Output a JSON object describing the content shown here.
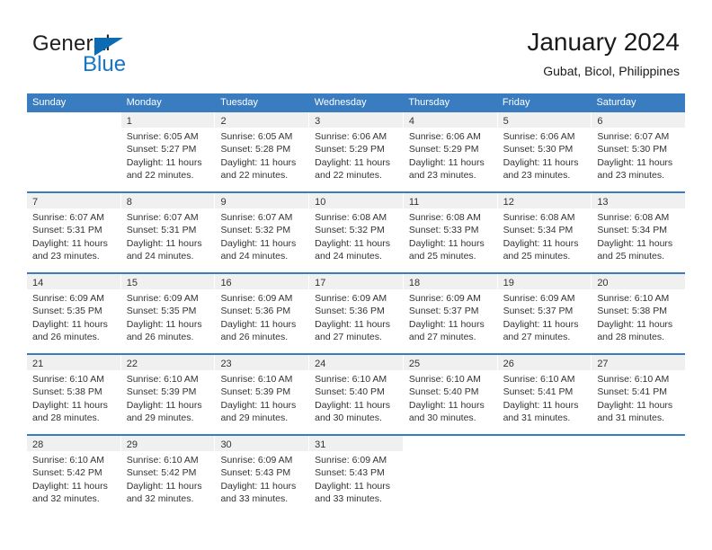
{
  "brand": {
    "name_part1": "General",
    "name_part2": "Blue",
    "triangle_icon": "triangle-icon",
    "color_blue": "#1676c6",
    "color_triangle": "#0b6cb3"
  },
  "header": {
    "title": "January 2024",
    "subtitle": "Gubat, Bicol, Philippines"
  },
  "theme": {
    "header_row_bg": "#3a7cc0",
    "daynum_band_bg": "#f0f0f0",
    "text_color": "#333333"
  },
  "weekdays": [
    "Sunday",
    "Monday",
    "Tuesday",
    "Wednesday",
    "Thursday",
    "Friday",
    "Saturday"
  ],
  "weeks": [
    [
      {
        "day": "",
        "sunrise": "",
        "sunset": "",
        "daylight_line1": "",
        "daylight_line2": ""
      },
      {
        "day": "1",
        "sunrise": "Sunrise: 6:05 AM",
        "sunset": "Sunset: 5:27 PM",
        "daylight_line1": "Daylight: 11 hours",
        "daylight_line2": "and 22 minutes."
      },
      {
        "day": "2",
        "sunrise": "Sunrise: 6:05 AM",
        "sunset": "Sunset: 5:28 PM",
        "daylight_line1": "Daylight: 11 hours",
        "daylight_line2": "and 22 minutes."
      },
      {
        "day": "3",
        "sunrise": "Sunrise: 6:06 AM",
        "sunset": "Sunset: 5:29 PM",
        "daylight_line1": "Daylight: 11 hours",
        "daylight_line2": "and 22 minutes."
      },
      {
        "day": "4",
        "sunrise": "Sunrise: 6:06 AM",
        "sunset": "Sunset: 5:29 PM",
        "daylight_line1": "Daylight: 11 hours",
        "daylight_line2": "and 23 minutes."
      },
      {
        "day": "5",
        "sunrise": "Sunrise: 6:06 AM",
        "sunset": "Sunset: 5:30 PM",
        "daylight_line1": "Daylight: 11 hours",
        "daylight_line2": "and 23 minutes."
      },
      {
        "day": "6",
        "sunrise": "Sunrise: 6:07 AM",
        "sunset": "Sunset: 5:30 PM",
        "daylight_line1": "Daylight: 11 hours",
        "daylight_line2": "and 23 minutes."
      }
    ],
    [
      {
        "day": "7",
        "sunrise": "Sunrise: 6:07 AM",
        "sunset": "Sunset: 5:31 PM",
        "daylight_line1": "Daylight: 11 hours",
        "daylight_line2": "and 23 minutes."
      },
      {
        "day": "8",
        "sunrise": "Sunrise: 6:07 AM",
        "sunset": "Sunset: 5:31 PM",
        "daylight_line1": "Daylight: 11 hours",
        "daylight_line2": "and 24 minutes."
      },
      {
        "day": "9",
        "sunrise": "Sunrise: 6:07 AM",
        "sunset": "Sunset: 5:32 PM",
        "daylight_line1": "Daylight: 11 hours",
        "daylight_line2": "and 24 minutes."
      },
      {
        "day": "10",
        "sunrise": "Sunrise: 6:08 AM",
        "sunset": "Sunset: 5:32 PM",
        "daylight_line1": "Daylight: 11 hours",
        "daylight_line2": "and 24 minutes."
      },
      {
        "day": "11",
        "sunrise": "Sunrise: 6:08 AM",
        "sunset": "Sunset: 5:33 PM",
        "daylight_line1": "Daylight: 11 hours",
        "daylight_line2": "and 25 minutes."
      },
      {
        "day": "12",
        "sunrise": "Sunrise: 6:08 AM",
        "sunset": "Sunset: 5:34 PM",
        "daylight_line1": "Daylight: 11 hours",
        "daylight_line2": "and 25 minutes."
      },
      {
        "day": "13",
        "sunrise": "Sunrise: 6:08 AM",
        "sunset": "Sunset: 5:34 PM",
        "daylight_line1": "Daylight: 11 hours",
        "daylight_line2": "and 25 minutes."
      }
    ],
    [
      {
        "day": "14",
        "sunrise": "Sunrise: 6:09 AM",
        "sunset": "Sunset: 5:35 PM",
        "daylight_line1": "Daylight: 11 hours",
        "daylight_line2": "and 26 minutes."
      },
      {
        "day": "15",
        "sunrise": "Sunrise: 6:09 AM",
        "sunset": "Sunset: 5:35 PM",
        "daylight_line1": "Daylight: 11 hours",
        "daylight_line2": "and 26 minutes."
      },
      {
        "day": "16",
        "sunrise": "Sunrise: 6:09 AM",
        "sunset": "Sunset: 5:36 PM",
        "daylight_line1": "Daylight: 11 hours",
        "daylight_line2": "and 26 minutes."
      },
      {
        "day": "17",
        "sunrise": "Sunrise: 6:09 AM",
        "sunset": "Sunset: 5:36 PM",
        "daylight_line1": "Daylight: 11 hours",
        "daylight_line2": "and 27 minutes."
      },
      {
        "day": "18",
        "sunrise": "Sunrise: 6:09 AM",
        "sunset": "Sunset: 5:37 PM",
        "daylight_line1": "Daylight: 11 hours",
        "daylight_line2": "and 27 minutes."
      },
      {
        "day": "19",
        "sunrise": "Sunrise: 6:09 AM",
        "sunset": "Sunset: 5:37 PM",
        "daylight_line1": "Daylight: 11 hours",
        "daylight_line2": "and 27 minutes."
      },
      {
        "day": "20",
        "sunrise": "Sunrise: 6:10 AM",
        "sunset": "Sunset: 5:38 PM",
        "daylight_line1": "Daylight: 11 hours",
        "daylight_line2": "and 28 minutes."
      }
    ],
    [
      {
        "day": "21",
        "sunrise": "Sunrise: 6:10 AM",
        "sunset": "Sunset: 5:38 PM",
        "daylight_line1": "Daylight: 11 hours",
        "daylight_line2": "and 28 minutes."
      },
      {
        "day": "22",
        "sunrise": "Sunrise: 6:10 AM",
        "sunset": "Sunset: 5:39 PM",
        "daylight_line1": "Daylight: 11 hours",
        "daylight_line2": "and 29 minutes."
      },
      {
        "day": "23",
        "sunrise": "Sunrise: 6:10 AM",
        "sunset": "Sunset: 5:39 PM",
        "daylight_line1": "Daylight: 11 hours",
        "daylight_line2": "and 29 minutes."
      },
      {
        "day": "24",
        "sunrise": "Sunrise: 6:10 AM",
        "sunset": "Sunset: 5:40 PM",
        "daylight_line1": "Daylight: 11 hours",
        "daylight_line2": "and 30 minutes."
      },
      {
        "day": "25",
        "sunrise": "Sunrise: 6:10 AM",
        "sunset": "Sunset: 5:40 PM",
        "daylight_line1": "Daylight: 11 hours",
        "daylight_line2": "and 30 minutes."
      },
      {
        "day": "26",
        "sunrise": "Sunrise: 6:10 AM",
        "sunset": "Sunset: 5:41 PM",
        "daylight_line1": "Daylight: 11 hours",
        "daylight_line2": "and 31 minutes."
      },
      {
        "day": "27",
        "sunrise": "Sunrise: 6:10 AM",
        "sunset": "Sunset: 5:41 PM",
        "daylight_line1": "Daylight: 11 hours",
        "daylight_line2": "and 31 minutes."
      }
    ],
    [
      {
        "day": "28",
        "sunrise": "Sunrise: 6:10 AM",
        "sunset": "Sunset: 5:42 PM",
        "daylight_line1": "Daylight: 11 hours",
        "daylight_line2": "and 32 minutes."
      },
      {
        "day": "29",
        "sunrise": "Sunrise: 6:10 AM",
        "sunset": "Sunset: 5:42 PM",
        "daylight_line1": "Daylight: 11 hours",
        "daylight_line2": "and 32 minutes."
      },
      {
        "day": "30",
        "sunrise": "Sunrise: 6:09 AM",
        "sunset": "Sunset: 5:43 PM",
        "daylight_line1": "Daylight: 11 hours",
        "daylight_line2": "and 33 minutes."
      },
      {
        "day": "31",
        "sunrise": "Sunrise: 6:09 AM",
        "sunset": "Sunset: 5:43 PM",
        "daylight_line1": "Daylight: 11 hours",
        "daylight_line2": "and 33 minutes."
      },
      {
        "day": "",
        "sunrise": "",
        "sunset": "",
        "daylight_line1": "",
        "daylight_line2": ""
      },
      {
        "day": "",
        "sunrise": "",
        "sunset": "",
        "daylight_line1": "",
        "daylight_line2": ""
      },
      {
        "day": "",
        "sunrise": "",
        "sunset": "",
        "daylight_line1": "",
        "daylight_line2": ""
      }
    ]
  ]
}
